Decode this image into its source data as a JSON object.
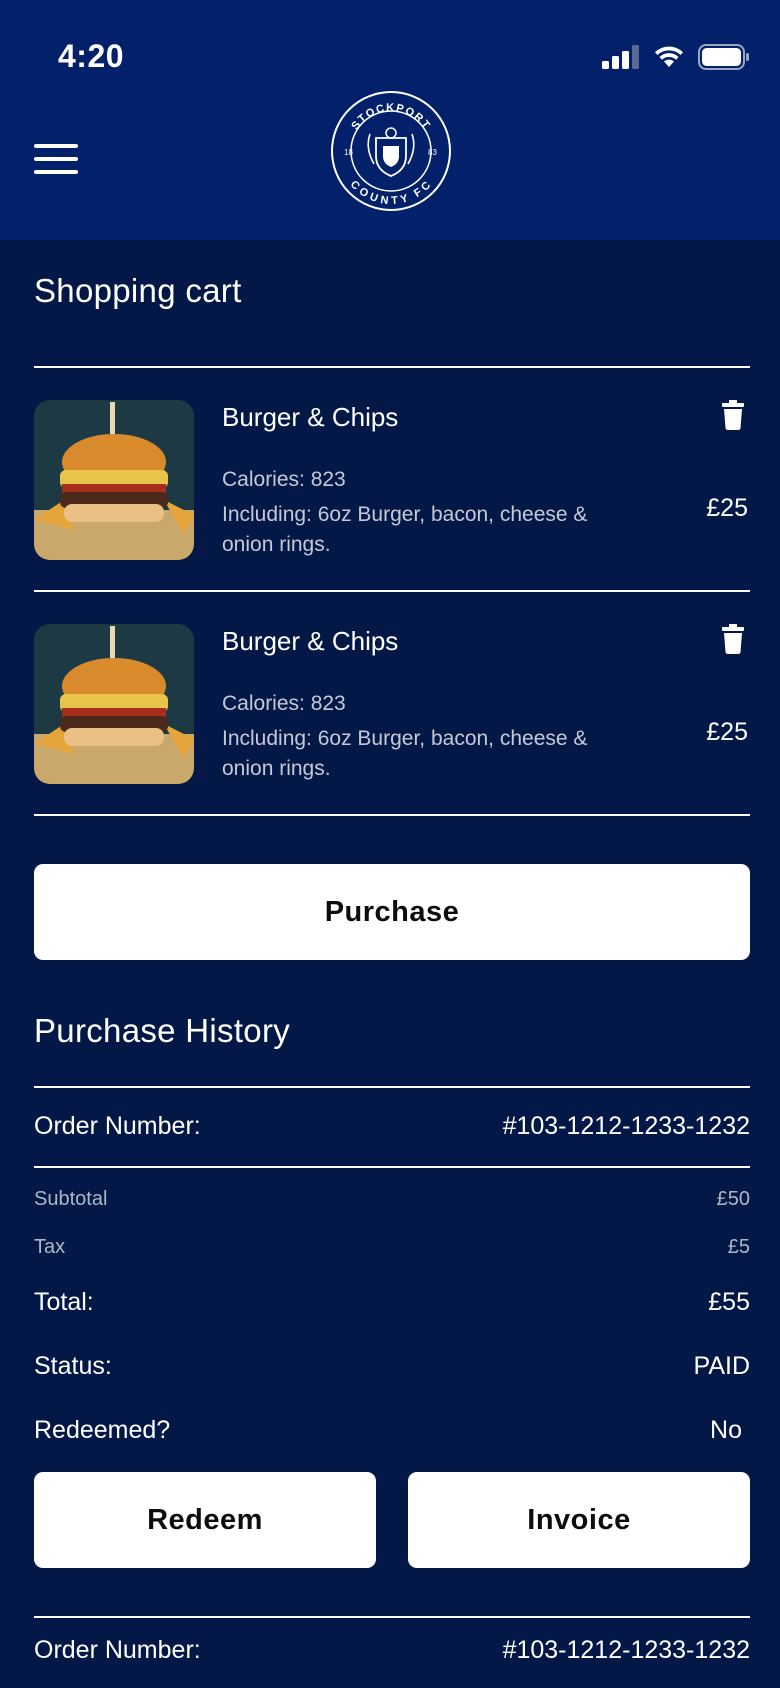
{
  "status_bar": {
    "time": "4:20"
  },
  "header": {
    "logo_top_text": "STOCKPORT",
    "logo_bottom_text": "COUNTY FC",
    "logo_left_num": "18",
    "logo_right_num": "83"
  },
  "cart": {
    "title": "Shopping cart",
    "items": [
      {
        "name": "Burger & Chips",
        "calories": "Calories: 823",
        "description": "Including: 6oz Burger, bacon, cheese & onion rings.",
        "price": "£25"
      },
      {
        "name": "Burger & Chips",
        "calories": "Calories: 823",
        "description": "Including: 6oz Burger, bacon, cheese & onion rings.",
        "price": "£25"
      }
    ],
    "purchase_label": "Purchase"
  },
  "history": {
    "title": "Purchase History",
    "orders": [
      {
        "order_label": "Order Number:",
        "order_number": "#103-1212-1233-1232",
        "subtotal_label": "Subtotal",
        "subtotal": "£50",
        "tax_label": "Tax",
        "tax": "£5",
        "total_label": "Total:",
        "total": "£55",
        "status_label": "Status:",
        "status": "PAID",
        "redeemed_label": "Redeemed?",
        "redeemed": "No",
        "redeem_button": "Redeem",
        "invoice_button": "Invoice"
      },
      {
        "order_label": "Order Number:",
        "order_number": "#103-1212-1233-1232"
      }
    ]
  }
}
